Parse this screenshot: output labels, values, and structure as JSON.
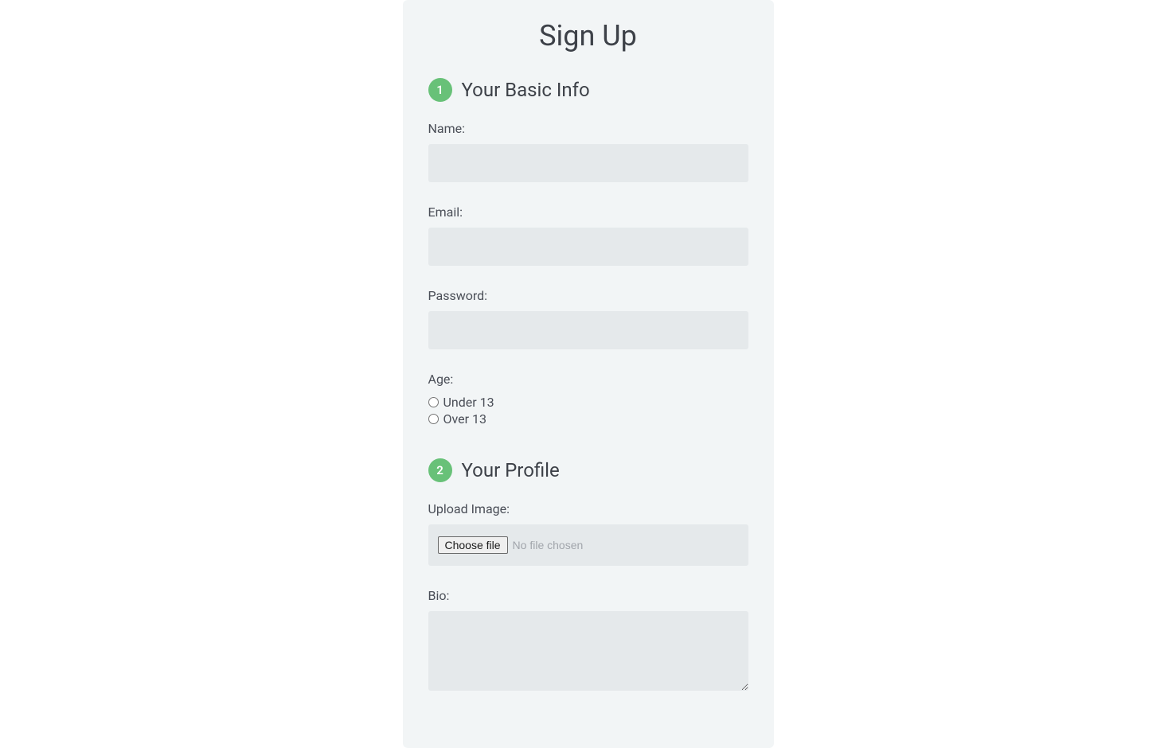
{
  "title": "Sign Up",
  "sections": {
    "basic": {
      "step": "1",
      "heading": "Your Basic Info",
      "fields": {
        "name": {
          "label": "Name:"
        },
        "email": {
          "label": "Email:"
        },
        "password": {
          "label": "Password:"
        },
        "age": {
          "label": "Age:",
          "options": {
            "under": "Under 13",
            "over": "Over 13"
          }
        }
      }
    },
    "profile": {
      "step": "2",
      "heading": "Your Profile",
      "fields": {
        "upload": {
          "label": "Upload Image:",
          "button": "Choose file",
          "status": "No file chosen"
        },
        "bio": {
          "label": "Bio:"
        }
      }
    }
  }
}
